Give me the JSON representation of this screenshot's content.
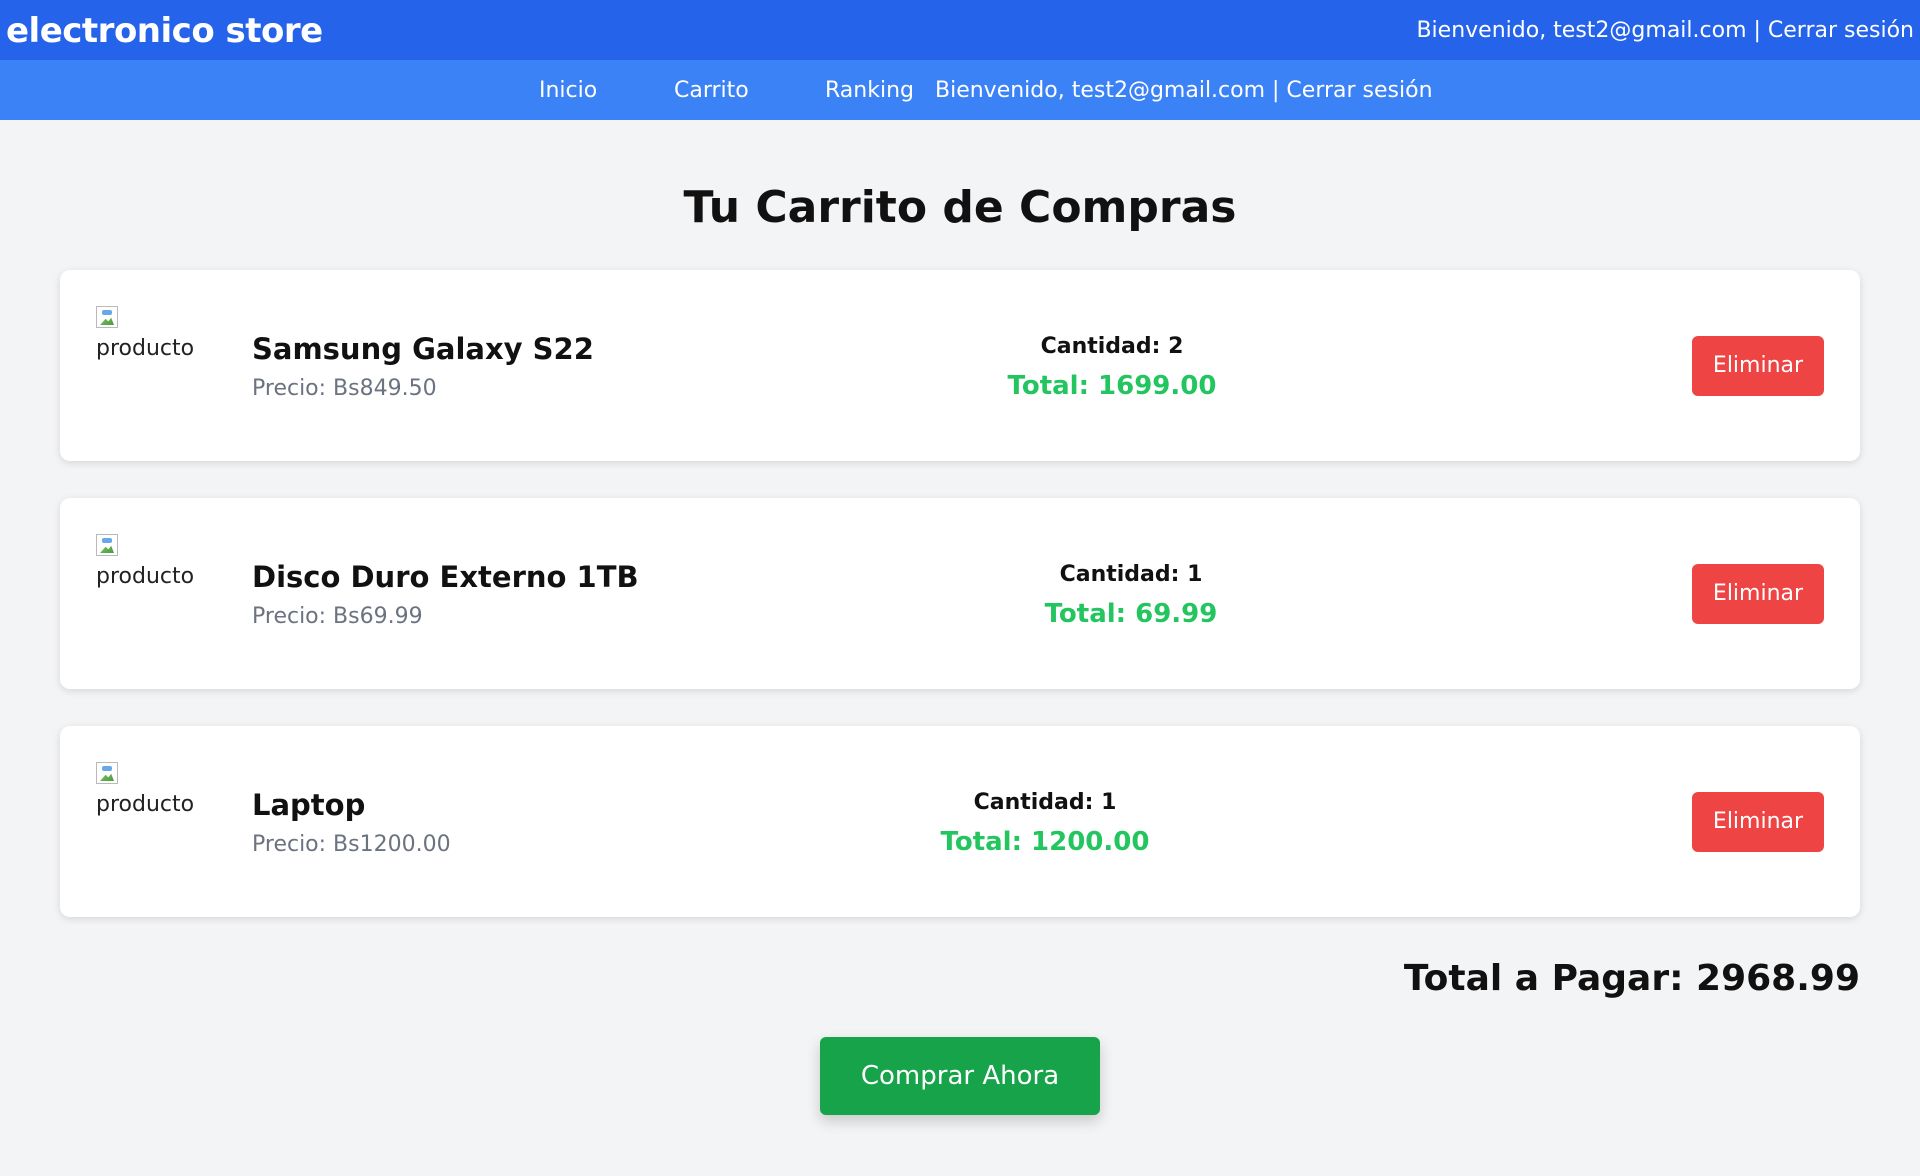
{
  "header": {
    "brand": "electronico store",
    "user_text": "Bienvenido, test2@gmail.com | Cerrar sesión"
  },
  "nav": {
    "items": [
      "Inicio",
      "Carrito",
      "Ranking"
    ],
    "user_text": "Bienvenido, test2@gmail.com | Cerrar sesión"
  },
  "page": {
    "title": "Tu Carrito de Compras"
  },
  "cart": {
    "items": [
      {
        "image_alt": "producto",
        "name": "Samsung Galaxy S22",
        "price": "Precio: Bs849.50",
        "quantity": "Cantidad: 2",
        "total": "Total: 1699.00",
        "remove_label": "Eliminar"
      },
      {
        "image_alt": "producto",
        "name": "Disco Duro Externo 1TB",
        "price": "Precio: Bs69.99",
        "quantity": "Cantidad: 1",
        "total": "Total: 69.99",
        "remove_label": "Eliminar"
      },
      {
        "image_alt": "producto",
        "name": "Laptop",
        "price": "Precio: Bs1200.00",
        "quantity": "Cantidad: 1",
        "total": "Total: 1200.00",
        "remove_label": "Eliminar"
      }
    ],
    "grand_total": "Total a Pagar: 2968.99",
    "buy_label": "Comprar Ahora"
  },
  "colors": {
    "header_bg": "#2563eb",
    "nav_bg": "#3b82f6",
    "total_green": "#22c55e",
    "remove_red": "#ef4444",
    "buy_green": "#16a34a"
  },
  "icons": {
    "product_image": "broken-image-icon"
  }
}
